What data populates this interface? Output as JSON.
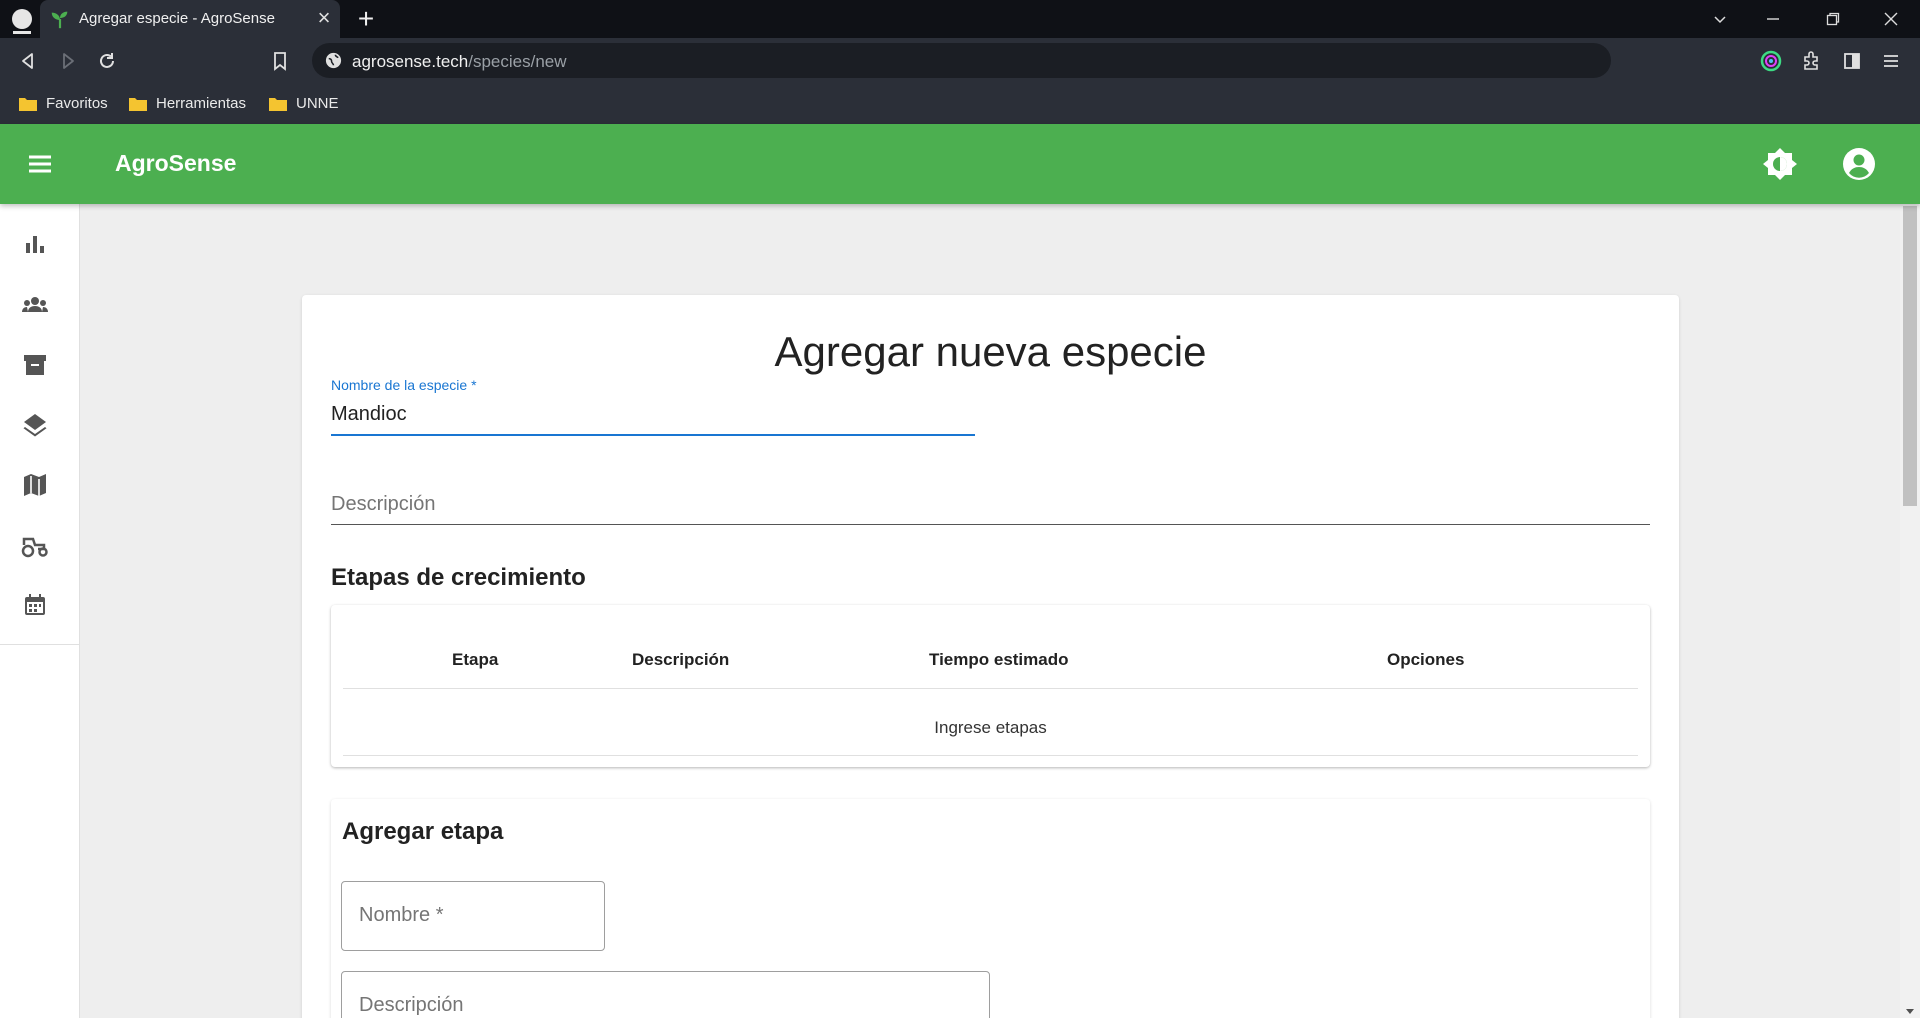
{
  "browser": {
    "tab_title": "Agregar especie - AgroSense",
    "url_host": "agrosense.tech",
    "url_path": "/species/new",
    "bookmarks": [
      "Favoritos",
      "Herramientas",
      "UNNE"
    ]
  },
  "app": {
    "title": "AgroSense",
    "accent_color": "#4caf50",
    "sidebar_icons": [
      "bar-chart-icon",
      "groups-icon",
      "archive-icon",
      "layers-icon",
      "map-icon",
      "tractor-icon",
      "calendar-icon"
    ]
  },
  "form": {
    "title": "Agregar nueva especie",
    "name_label": "Nombre de la especie *",
    "name_value": "Mandioc",
    "description_placeholder": "Descripción"
  },
  "stages_table": {
    "section_title": "Etapas de crecimiento",
    "columns": [
      "Etapa",
      "Descripción",
      "Tiempo estimado",
      "Opciones"
    ],
    "empty_text": "Ingrese etapas"
  },
  "add_stage": {
    "title": "Agregar etapa",
    "name_placeholder": "Nombre *",
    "description_placeholder": "Descripción"
  }
}
